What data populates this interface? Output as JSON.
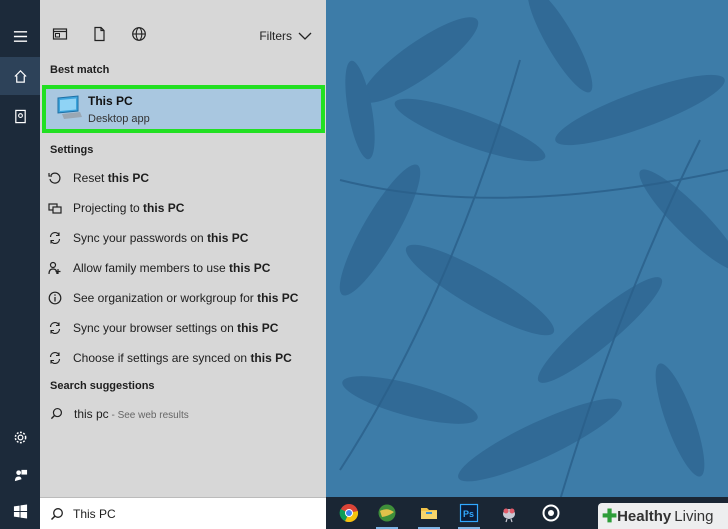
{
  "top_tabs": [
    {
      "icon": "apps-icon"
    },
    {
      "icon": "document-icon"
    },
    {
      "icon": "web-icon"
    }
  ],
  "filters_label": "Filters",
  "best_match": {
    "heading": "Best match",
    "title": "This PC",
    "subtitle": "Desktop app"
  },
  "settings": {
    "heading": "Settings",
    "items": [
      {
        "pre": "Reset ",
        "bold": "this PC",
        "post": "",
        "icon": "reset-icon"
      },
      {
        "pre": "Projecting to ",
        "bold": "this PC",
        "post": "",
        "icon": "project-icon"
      },
      {
        "pre": "Sync your passwords on ",
        "bold": "this PC",
        "post": "",
        "icon": "sync-icon"
      },
      {
        "pre": "Allow family members to use ",
        "bold": "this PC",
        "post": "",
        "icon": "family-icon"
      },
      {
        "pre": "See organization or workgroup for ",
        "bold": "this PC",
        "post": "",
        "icon": "info-icon"
      },
      {
        "pre": "Sync your browser settings on ",
        "bold": "this PC",
        "post": "",
        "icon": "sync-icon"
      },
      {
        "pre": "Choose if settings are synced on ",
        "bold": "this PC",
        "post": "",
        "icon": "sync-icon"
      }
    ]
  },
  "suggestions": {
    "heading": "Search suggestions",
    "query": "this pc",
    "hint": " - See web results"
  },
  "search_box": {
    "value": "This PC"
  },
  "watermark": {
    "bold": "Healthy",
    "rest": "Living"
  },
  "colors": {
    "highlight_border": "#22e022",
    "selected_bg": "#a9c7e0",
    "rail_bg": "#1c2a3a",
    "taskbar_bg": "#1a2634",
    "panel_bg": "#d7d7d7"
  }
}
